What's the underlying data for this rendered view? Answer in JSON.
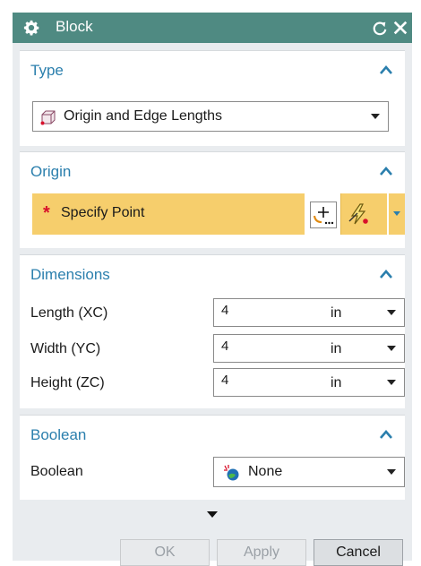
{
  "titlebar": {
    "title": "Block",
    "icon": "gear-icon"
  },
  "type_group": {
    "title": "Type",
    "selected": "Origin and Edge Lengths",
    "icon": "block-cube-icon"
  },
  "origin_group": {
    "title": "Origin",
    "required_marker": "*",
    "specify_label": "Specify Point"
  },
  "dimensions_group": {
    "title": "Dimensions",
    "rows": [
      {
        "label": "Length (XC)",
        "value": "4",
        "unit": "in"
      },
      {
        "label": "Width (YC)",
        "value": "4",
        "unit": "in"
      },
      {
        "label": "Height (ZC)",
        "value": "4",
        "unit": "in"
      }
    ]
  },
  "boolean_group": {
    "title": "Boolean",
    "label": "Boolean",
    "selected": "None"
  },
  "buttons": {
    "ok": "OK",
    "apply": "Apply",
    "cancel": "Cancel"
  },
  "colors": {
    "titlebar": "#4f8a82",
    "group_title": "#2b7fad",
    "required_highlight": "#f6ce6c",
    "required_star": "#d8102b"
  }
}
